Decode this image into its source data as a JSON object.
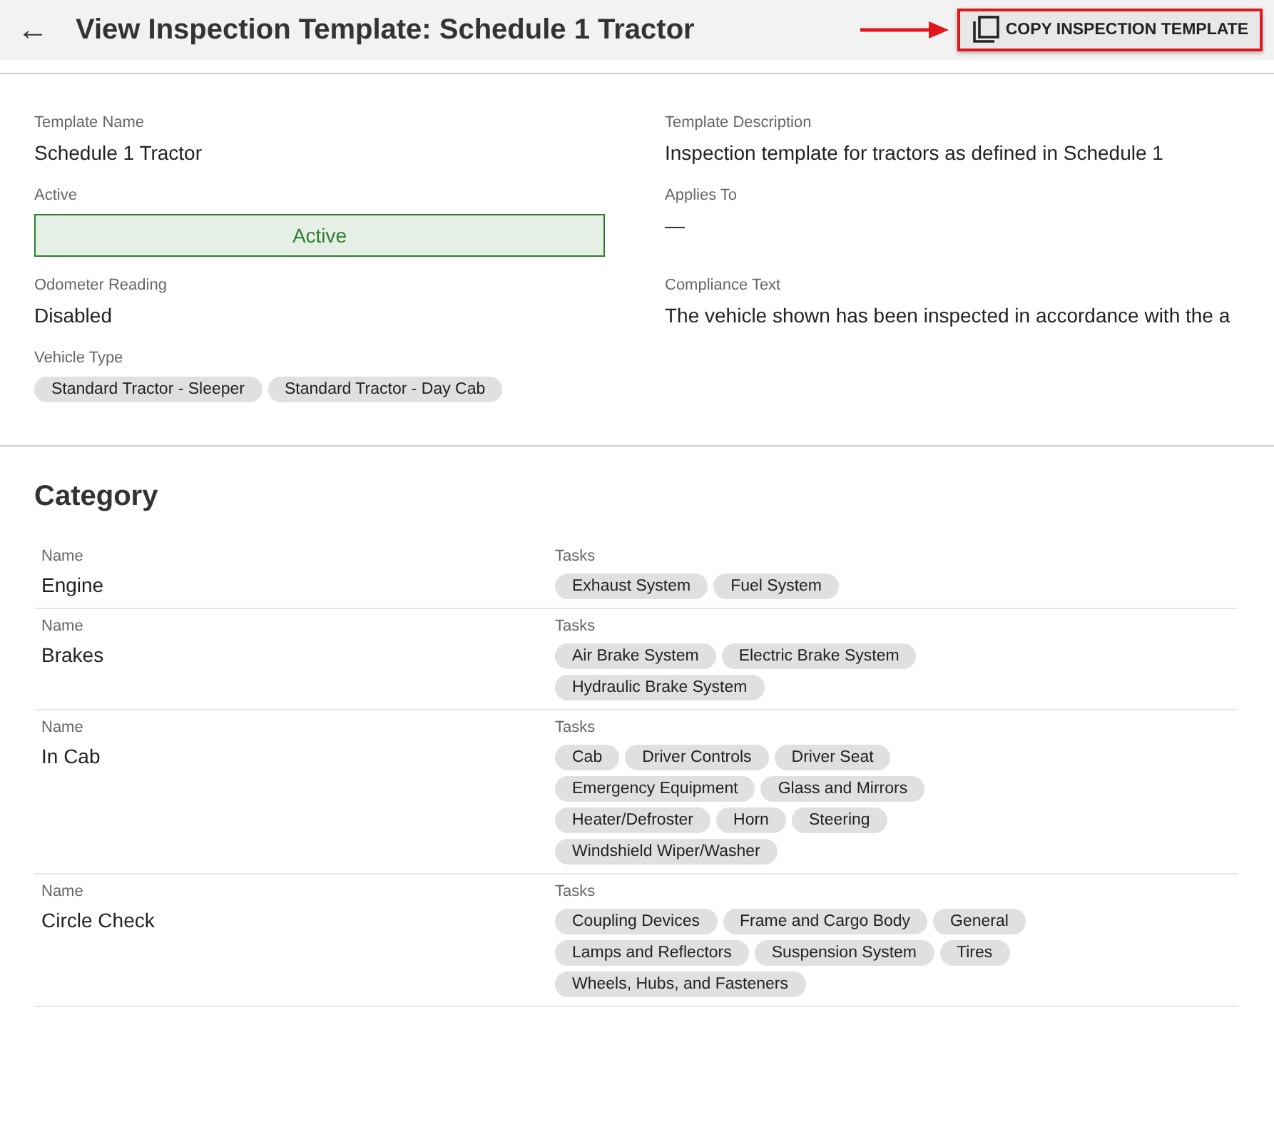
{
  "header": {
    "back": "←",
    "title": "View Inspection Template: Schedule 1 Tractor",
    "copy_button": {
      "label": "COPY INSPECTION TEMPLATE",
      "highlighted": true
    }
  },
  "fields": [
    {
      "label": "Template Name",
      "value": "Schedule 1 Tractor",
      "kind": "text"
    },
    {
      "label": "Template Description",
      "value": "Inspection template for tractors as defined in Schedule 1",
      "kind": "text"
    },
    {
      "label": "Active",
      "value": "Active",
      "kind": "status",
      "on": true
    },
    {
      "label": "Applies To",
      "value": "—",
      "kind": "text"
    },
    {
      "label": "Odometer Reading",
      "value": "Disabled",
      "kind": "text"
    },
    {
      "label": "Compliance Text",
      "value": "The vehicle shown has been inspected in accordance with the a",
      "kind": "text"
    },
    {
      "label": "Vehicle Type",
      "kind": "chips",
      "chips": [
        "Standard Tractor - Sleeper",
        "Standard Tractor - Day Cab"
      ]
    }
  ],
  "category": {
    "heading": "Category",
    "rows": [
      {
        "name_label": "Name",
        "name": "Engine",
        "tasks_label": "Tasks",
        "tasks": [
          "Exhaust System",
          "Fuel System"
        ]
      },
      {
        "name_label": "Name",
        "name": "Brakes",
        "tasks_label": "Tasks",
        "tasks": [
          "Air Brake System",
          "Electric Brake System",
          "Hydraulic Brake System"
        ]
      },
      {
        "name_label": "Name",
        "name": "In Cab",
        "tasks_label": "Tasks",
        "tasks": [
          "Cab",
          "Driver Controls",
          "Driver Seat",
          "Emergency Equipment",
          "Glass and Mirrors",
          "Heater/Defroster",
          "Horn",
          "Steering",
          "Windshield Wiper/Washer"
        ]
      },
      {
        "name_label": "Name",
        "name": "Circle Check",
        "tasks_label": "Tasks",
        "tasks": [
          "Coupling Devices",
          "Frame and Cargo Body",
          "General",
          "Lamps and Reflectors",
          "Suspension System",
          "Tires",
          "Wheels, Hubs, and Fasteners"
        ]
      }
    ]
  }
}
